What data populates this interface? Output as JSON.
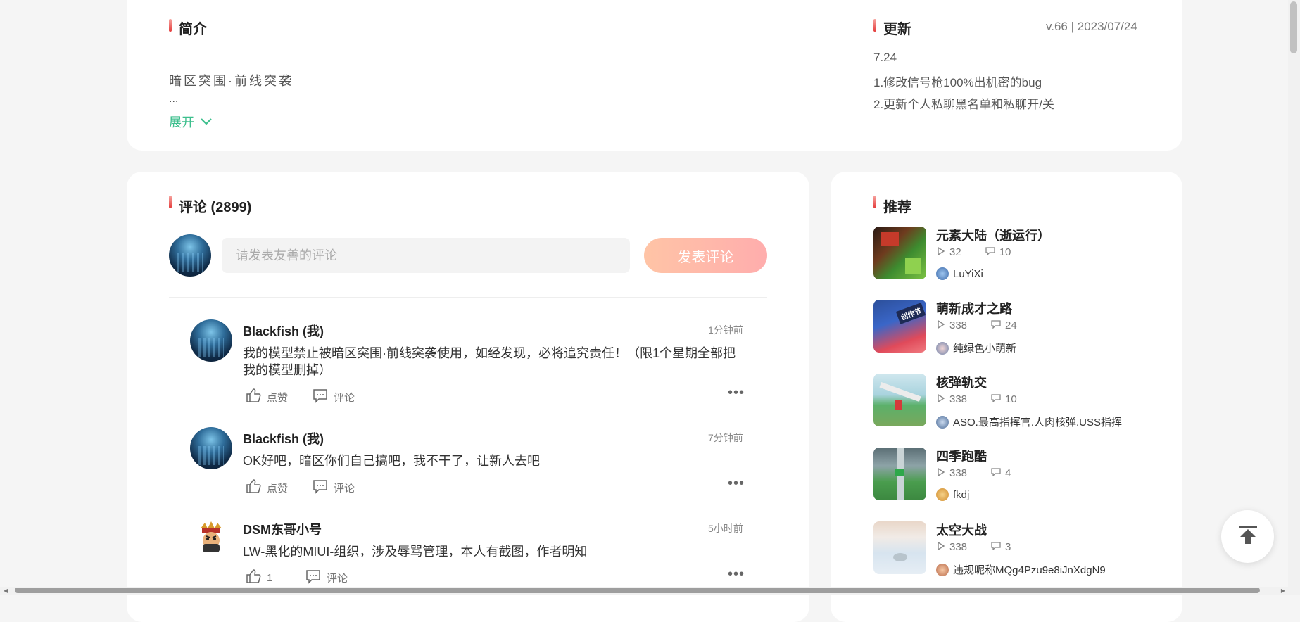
{
  "intro": {
    "title": "简介",
    "text": "暗区突围·前线突袭",
    "ellipsis": "...",
    "expand_label": "展开"
  },
  "update": {
    "title": "更新",
    "version": "v.66 | 2023/07/24",
    "lines": [
      "7.24",
      "1.修改信号枪100%出机密的bug",
      "2.更新个人私聊黑名单和私聊开/关"
    ]
  },
  "comments": {
    "title": "评论 (2899)",
    "input_placeholder": "请发表友善的评论",
    "post_button": "发表评论",
    "items": [
      {
        "user": "Blackfish (我)",
        "time": "1分钟前",
        "text": "我的模型禁止被暗区突围·前线突袭使用，如经发现，必将追究责任！（限1个星期全部把我的模型删掉）",
        "like_label": "点赞",
        "comment_label": "评论"
      },
      {
        "user": "Blackfish (我)",
        "time": "7分钟前",
        "text": "OK好吧，暗区你们自己搞吧，我不干了，让新人去吧",
        "like_label": "点赞",
        "comment_label": "评论"
      },
      {
        "user": "DSM东哥小号",
        "time": "5小时前",
        "text": "LW-黑化的MIUI-组织，涉及辱骂管理，本人有截图，作者明知",
        "like_label": "1",
        "comment_label": "评论"
      }
    ]
  },
  "recommend": {
    "title": "推荐",
    "items": [
      {
        "title": "元素大陆（逝运行）",
        "plays": "32",
        "comments": "10",
        "author": "LuYiXi"
      },
      {
        "title": "萌新成才之路",
        "plays": "338",
        "comments": "24",
        "author": "纯绿色小萌新"
      },
      {
        "title": "核弹轨交",
        "plays": "338",
        "comments": "10",
        "author": "ASO.最高指挥官.人肉核弹.USS指挥"
      },
      {
        "title": "四季跑酷",
        "plays": "338",
        "comments": "4",
        "author": "fkdj"
      },
      {
        "title": "太空大战",
        "plays": "338",
        "comments": "3",
        "author": "违规昵称MQg4Pzu9e8iJnXdgN9"
      }
    ],
    "thumb_label": "创作节"
  },
  "colors": {
    "accent_green": "#3dbf8d",
    "post_button_gradient": [
      "#ffc4a6",
      "#ffadad"
    ],
    "title_bar": "#e43b3b"
  }
}
